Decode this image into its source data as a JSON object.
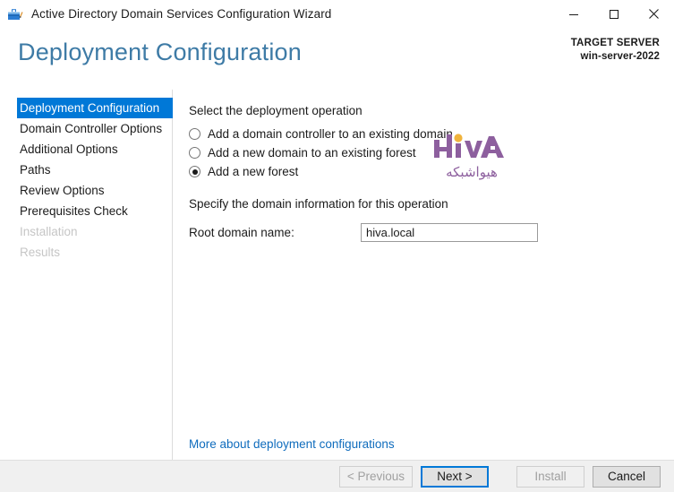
{
  "window": {
    "title": "Active Directory Domain Services Configuration Wizard",
    "icon": "wizard-toolbox-icon",
    "controls": {
      "minimize": "minimize-icon",
      "maximize": "maximize-icon",
      "close": "close-icon"
    }
  },
  "header": {
    "page_title": "Deployment Configuration",
    "target_server_label": "TARGET SERVER",
    "target_server_name": "win-server-2022"
  },
  "sidebar": {
    "items": [
      {
        "label": "Deployment Configuration",
        "state": "selected"
      },
      {
        "label": "Domain Controller Options",
        "state": "enabled"
      },
      {
        "label": "Additional Options",
        "state": "enabled"
      },
      {
        "label": "Paths",
        "state": "enabled"
      },
      {
        "label": "Review Options",
        "state": "enabled"
      },
      {
        "label": "Prerequisites Check",
        "state": "enabled"
      },
      {
        "label": "Installation",
        "state": "disabled"
      },
      {
        "label": "Results",
        "state": "disabled"
      }
    ]
  },
  "main": {
    "operation_heading": "Select the deployment operation",
    "operations": [
      {
        "label": "Add a domain controller to an existing domain",
        "checked": false
      },
      {
        "label": "Add a new domain to an existing forest",
        "checked": false
      },
      {
        "label": "Add a new forest",
        "checked": true
      }
    ],
    "domain_heading": "Specify the domain information for this operation",
    "root_domain_label": "Root domain name:",
    "root_domain_value": "hiva.local",
    "more_link": "More about deployment configurations"
  },
  "watermark": {
    "logo_text": "HIVA",
    "persian_text": "هیواشبکه",
    "color": "#8d5f9e",
    "accent_color": "#f0b33c"
  },
  "footer": {
    "buttons": [
      {
        "label": "< Previous",
        "state": "disabled"
      },
      {
        "label": "Next >",
        "state": "focused"
      },
      {
        "label": "Install",
        "state": "disabled"
      },
      {
        "label": "Cancel",
        "state": "enabled"
      }
    ]
  },
  "colors": {
    "accent": "#0078d7",
    "title_blue": "#3e7ba6",
    "link": "#0f6cbd",
    "footer_bg": "#f0f0f0"
  }
}
